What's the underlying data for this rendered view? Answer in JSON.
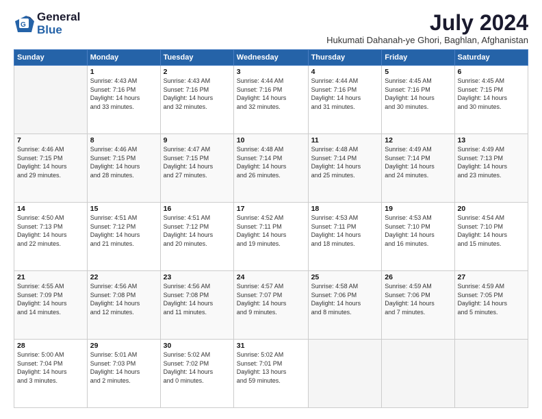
{
  "header": {
    "logo_general": "General",
    "logo_blue": "Blue",
    "month_title": "July 2024",
    "subtitle": "Hukumati Dahanah-ye Ghori, Baghlan, Afghanistan"
  },
  "weekdays": [
    "Sunday",
    "Monday",
    "Tuesday",
    "Wednesday",
    "Thursday",
    "Friday",
    "Saturday"
  ],
  "weeks": [
    [
      {
        "day": "",
        "info": ""
      },
      {
        "day": "1",
        "info": "Sunrise: 4:43 AM\nSunset: 7:16 PM\nDaylight: 14 hours\nand 33 minutes."
      },
      {
        "day": "2",
        "info": "Sunrise: 4:43 AM\nSunset: 7:16 PM\nDaylight: 14 hours\nand 32 minutes."
      },
      {
        "day": "3",
        "info": "Sunrise: 4:44 AM\nSunset: 7:16 PM\nDaylight: 14 hours\nand 32 minutes."
      },
      {
        "day": "4",
        "info": "Sunrise: 4:44 AM\nSunset: 7:16 PM\nDaylight: 14 hours\nand 31 minutes."
      },
      {
        "day": "5",
        "info": "Sunrise: 4:45 AM\nSunset: 7:16 PM\nDaylight: 14 hours\nand 30 minutes."
      },
      {
        "day": "6",
        "info": "Sunrise: 4:45 AM\nSunset: 7:15 PM\nDaylight: 14 hours\nand 30 minutes."
      }
    ],
    [
      {
        "day": "7",
        "info": "Sunrise: 4:46 AM\nSunset: 7:15 PM\nDaylight: 14 hours\nand 29 minutes."
      },
      {
        "day": "8",
        "info": "Sunrise: 4:46 AM\nSunset: 7:15 PM\nDaylight: 14 hours\nand 28 minutes."
      },
      {
        "day": "9",
        "info": "Sunrise: 4:47 AM\nSunset: 7:15 PM\nDaylight: 14 hours\nand 27 minutes."
      },
      {
        "day": "10",
        "info": "Sunrise: 4:48 AM\nSunset: 7:14 PM\nDaylight: 14 hours\nand 26 minutes."
      },
      {
        "day": "11",
        "info": "Sunrise: 4:48 AM\nSunset: 7:14 PM\nDaylight: 14 hours\nand 25 minutes."
      },
      {
        "day": "12",
        "info": "Sunrise: 4:49 AM\nSunset: 7:14 PM\nDaylight: 14 hours\nand 24 minutes."
      },
      {
        "day": "13",
        "info": "Sunrise: 4:49 AM\nSunset: 7:13 PM\nDaylight: 14 hours\nand 23 minutes."
      }
    ],
    [
      {
        "day": "14",
        "info": "Sunrise: 4:50 AM\nSunset: 7:13 PM\nDaylight: 14 hours\nand 22 minutes."
      },
      {
        "day": "15",
        "info": "Sunrise: 4:51 AM\nSunset: 7:12 PM\nDaylight: 14 hours\nand 21 minutes."
      },
      {
        "day": "16",
        "info": "Sunrise: 4:51 AM\nSunset: 7:12 PM\nDaylight: 14 hours\nand 20 minutes."
      },
      {
        "day": "17",
        "info": "Sunrise: 4:52 AM\nSunset: 7:11 PM\nDaylight: 14 hours\nand 19 minutes."
      },
      {
        "day": "18",
        "info": "Sunrise: 4:53 AM\nSunset: 7:11 PM\nDaylight: 14 hours\nand 18 minutes."
      },
      {
        "day": "19",
        "info": "Sunrise: 4:53 AM\nSunset: 7:10 PM\nDaylight: 14 hours\nand 16 minutes."
      },
      {
        "day": "20",
        "info": "Sunrise: 4:54 AM\nSunset: 7:10 PM\nDaylight: 14 hours\nand 15 minutes."
      }
    ],
    [
      {
        "day": "21",
        "info": "Sunrise: 4:55 AM\nSunset: 7:09 PM\nDaylight: 14 hours\nand 14 minutes."
      },
      {
        "day": "22",
        "info": "Sunrise: 4:56 AM\nSunset: 7:08 PM\nDaylight: 14 hours\nand 12 minutes."
      },
      {
        "day": "23",
        "info": "Sunrise: 4:56 AM\nSunset: 7:08 PM\nDaylight: 14 hours\nand 11 minutes."
      },
      {
        "day": "24",
        "info": "Sunrise: 4:57 AM\nSunset: 7:07 PM\nDaylight: 14 hours\nand 9 minutes."
      },
      {
        "day": "25",
        "info": "Sunrise: 4:58 AM\nSunset: 7:06 PM\nDaylight: 14 hours\nand 8 minutes."
      },
      {
        "day": "26",
        "info": "Sunrise: 4:59 AM\nSunset: 7:06 PM\nDaylight: 14 hours\nand 7 minutes."
      },
      {
        "day": "27",
        "info": "Sunrise: 4:59 AM\nSunset: 7:05 PM\nDaylight: 14 hours\nand 5 minutes."
      }
    ],
    [
      {
        "day": "28",
        "info": "Sunrise: 5:00 AM\nSunset: 7:04 PM\nDaylight: 14 hours\nand 3 minutes."
      },
      {
        "day": "29",
        "info": "Sunrise: 5:01 AM\nSunset: 7:03 PM\nDaylight: 14 hours\nand 2 minutes."
      },
      {
        "day": "30",
        "info": "Sunrise: 5:02 AM\nSunset: 7:02 PM\nDaylight: 14 hours\nand 0 minutes."
      },
      {
        "day": "31",
        "info": "Sunrise: 5:02 AM\nSunset: 7:01 PM\nDaylight: 13 hours\nand 59 minutes."
      },
      {
        "day": "",
        "info": ""
      },
      {
        "day": "",
        "info": ""
      },
      {
        "day": "",
        "info": ""
      }
    ]
  ]
}
